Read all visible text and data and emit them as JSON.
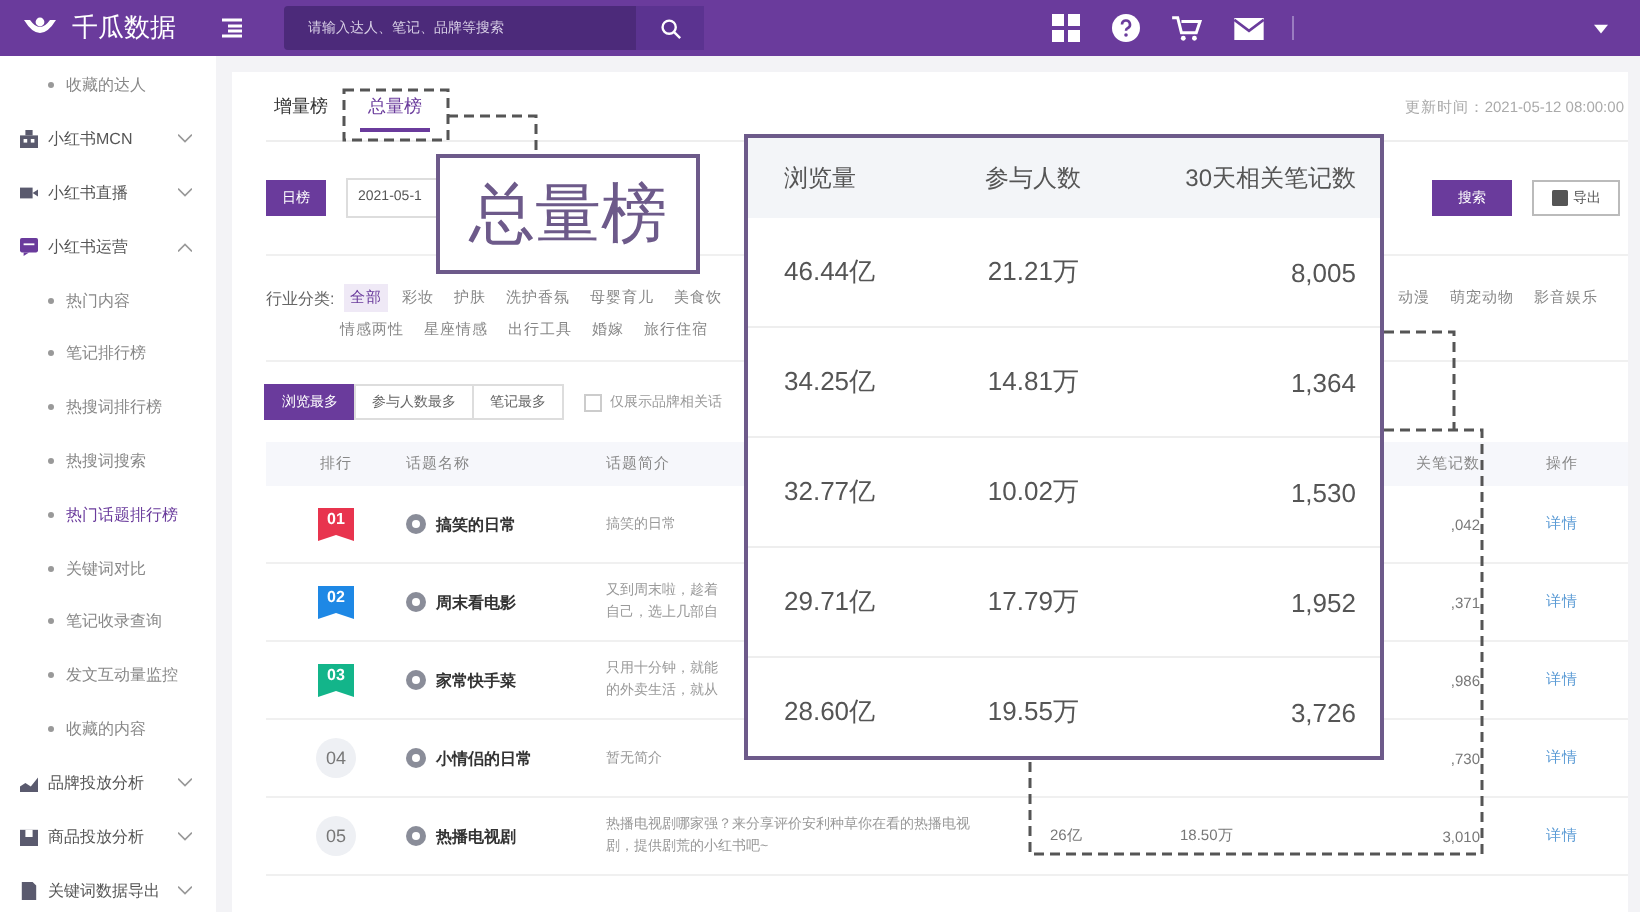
{
  "topbar": {
    "logo_text": "千瓜数据",
    "search": {
      "placeholder": "请输入达人、笔记、品牌等搜索"
    }
  },
  "sidebar": {
    "items": [
      {
        "kind": "sub",
        "label": "收藏的达人",
        "selected": false
      },
      {
        "kind": "group",
        "label": "小红书MCN",
        "expanded": false
      },
      {
        "kind": "group",
        "label": "小红书直播",
        "expanded": false
      },
      {
        "kind": "group",
        "label": "小红书运营",
        "expanded": true,
        "children": [
          {
            "kind": "sub",
            "label": "热门内容",
            "selected": false
          },
          {
            "kind": "sub",
            "label": "笔记排行榜",
            "selected": false
          },
          {
            "kind": "sub",
            "label": "热搜词排行榜",
            "selected": false
          },
          {
            "kind": "sub",
            "label": "热搜词搜索",
            "selected": false
          },
          {
            "kind": "sub",
            "label": "热门话题排行榜",
            "selected": true
          },
          {
            "kind": "sub",
            "label": "关键词对比",
            "selected": false
          },
          {
            "kind": "sub",
            "label": "笔记收录查询",
            "selected": false
          },
          {
            "kind": "sub",
            "label": "发文互动量监控",
            "selected": false
          },
          {
            "kind": "sub",
            "label": "收藏的内容",
            "selected": false
          }
        ]
      },
      {
        "kind": "group",
        "label": "品牌投放分析",
        "expanded": false
      },
      {
        "kind": "group",
        "label": "商品投放分析",
        "expanded": false
      },
      {
        "kind": "group",
        "label": "关键词数据导出",
        "expanded": false
      }
    ]
  },
  "tabs": [
    {
      "label": "增量榜",
      "selected": false
    },
    {
      "label": "总量榜",
      "selected": true
    }
  ],
  "update_time": "更新时间：2021-05-12 08:00:00",
  "period_button": {
    "label": "日榜",
    "selected": true
  },
  "date_field": {
    "value": "2021-05-1"
  },
  "search_button": "搜索",
  "export_button": "导出",
  "industry": {
    "label": "行业分类:",
    "tags": [
      {
        "label": "全部",
        "selected": true
      },
      {
        "label": "彩妆",
        "selected": false
      },
      {
        "label": "护肤",
        "selected": false
      },
      {
        "label": "洗护香氛",
        "selected": false
      },
      {
        "label": "母婴育儿",
        "selected": false
      },
      {
        "label": "美食饮",
        "selected": false
      }
    ],
    "tags_right": [
      {
        "label": "动漫",
        "selected": false
      },
      {
        "label": "萌宠动物",
        "selected": false
      },
      {
        "label": "影音娱乐",
        "selected": false
      }
    ],
    "tags_line2": [
      {
        "label": "情感两性",
        "selected": false
      },
      {
        "label": "星座情感",
        "selected": false
      },
      {
        "label": "出行工具",
        "selected": false
      },
      {
        "label": "婚嫁",
        "selected": false
      },
      {
        "label": "旅行住宿",
        "selected": false
      }
    ]
  },
  "sort_buttons": [
    {
      "label": "浏览最多",
      "selected": true
    },
    {
      "label": "参与人数最多",
      "selected": false
    },
    {
      "label": "笔记最多",
      "selected": false
    }
  ],
  "brand_filter": {
    "label": "仅展示品牌相关话",
    "checked": false
  },
  "table": {
    "columns": [
      "排行",
      "话题名称",
      "话题简介",
      "关笔记数",
      "操作"
    ],
    "rows": [
      {
        "rank": "01",
        "kind": "ribbon",
        "color": "#e8344e",
        "name": "搞笑的日常",
        "intro": [
          "搞笑的日常"
        ],
        "notes": ",042",
        "action": "详情"
      },
      {
        "rank": "02",
        "kind": "ribbon",
        "color": "#1e88e5",
        "name": "周末看电影",
        "intro": [
          "又到周末啦，趁着",
          "自己，选上几部自"
        ],
        "notes": ",371",
        "action": "详情"
      },
      {
        "rank": "03",
        "kind": "ribbon",
        "color": "#13b58a",
        "name": "家常快手菜",
        "intro": [
          "只用十分钟，就能",
          "的外卖生活，就从"
        ],
        "notes": ",986",
        "action": "详情"
      },
      {
        "rank": "04",
        "kind": "plain",
        "name": "小情侣的日常",
        "intro": [
          "暂无简介"
        ],
        "notes": ",730",
        "action": "详情"
      },
      {
        "rank": "05",
        "kind": "plain",
        "name": "热播电视剧",
        "intro": [
          "热播电视剧哪家强？来分享评价安利种草你在看的热播电视",
          "剧，提供剧荒的小红书吧~"
        ],
        "views": "26亿",
        "participants": "18.50万",
        "notes": "3,010",
        "action": "详情"
      }
    ]
  },
  "callout_label": "总量榜",
  "zoom_panel": {
    "columns": [
      "浏览量",
      "参与人数",
      "30天相关笔记数"
    ],
    "rows": [
      [
        "46.44亿",
        "21.21万",
        "8,005"
      ],
      [
        "34.25亿",
        "14.81万",
        "1,364"
      ],
      [
        "32.77亿",
        "10.02万",
        "1,530"
      ],
      [
        "29.71亿",
        "17.79万",
        "1,952"
      ],
      [
        "28.60亿",
        "19.55万",
        "3,726"
      ]
    ]
  }
}
